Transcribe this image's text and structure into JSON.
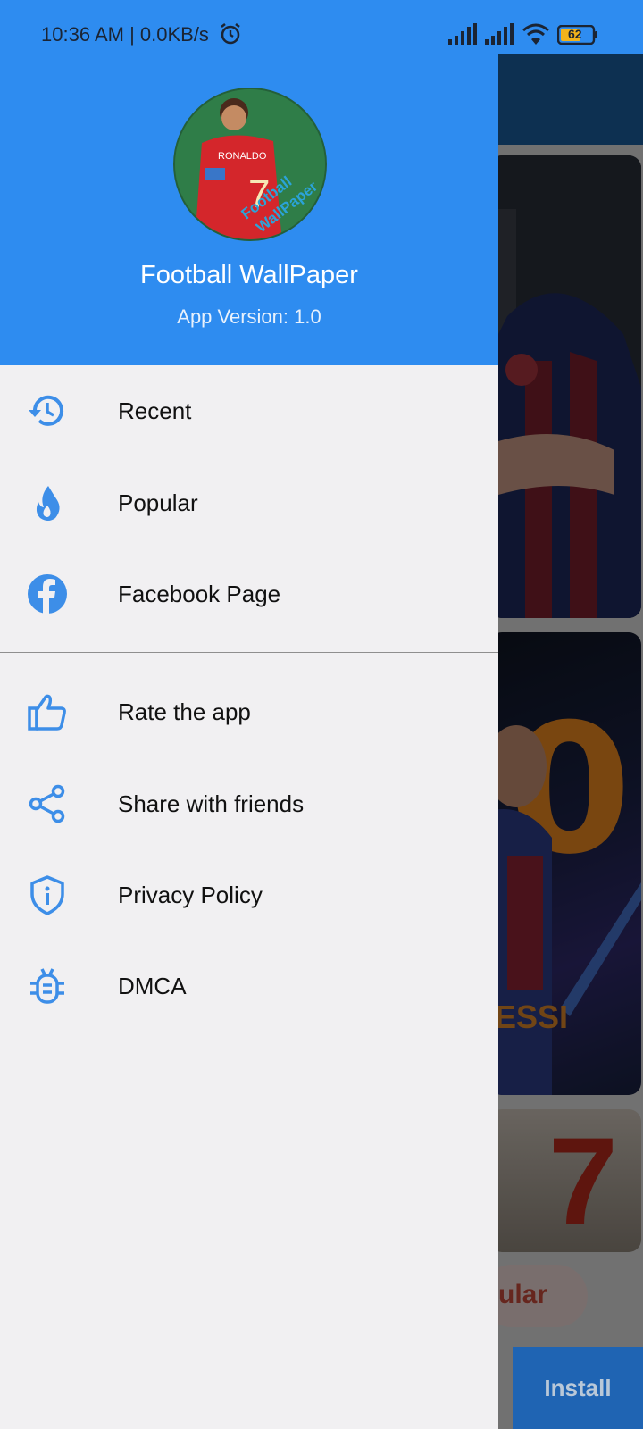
{
  "status_bar": {
    "time": "10:36 AM | 0.0KB/s",
    "battery": "62",
    "icons": [
      "alarm-icon",
      "signal-icon",
      "signal-icon",
      "wifi-icon",
      "battery-icon"
    ]
  },
  "drawer": {
    "app_name": "Football WallPaper",
    "app_version": "App Version: 1.0",
    "avatar_text": {
      "jersey_name": "RONALDO",
      "jersey_number": "7",
      "logo_line1": "Football",
      "logo_line2": "WallPaper"
    },
    "menu": [
      {
        "label": "Recent",
        "icon": "history-icon"
      },
      {
        "label": "Popular",
        "icon": "fire-icon"
      },
      {
        "label": "Facebook Page",
        "icon": "facebook-icon"
      }
    ],
    "menu2": [
      {
        "label": "Rate the app",
        "icon": "thumbs-up-icon"
      },
      {
        "label": "Share with friends",
        "icon": "share-icon"
      },
      {
        "label": "Privacy Policy",
        "icon": "shield-info-icon"
      },
      {
        "label": "DMCA",
        "icon": "bug-icon"
      }
    ]
  },
  "background_app": {
    "card2_number": "0",
    "card2_name": "ESSI",
    "card3_number": "7",
    "chip_label": "ular",
    "install_label": "Install"
  },
  "colors": {
    "primary": "#2e8cf0",
    "icon": "#3d8ee8",
    "drawer_bg": "#f1f0f2"
  }
}
